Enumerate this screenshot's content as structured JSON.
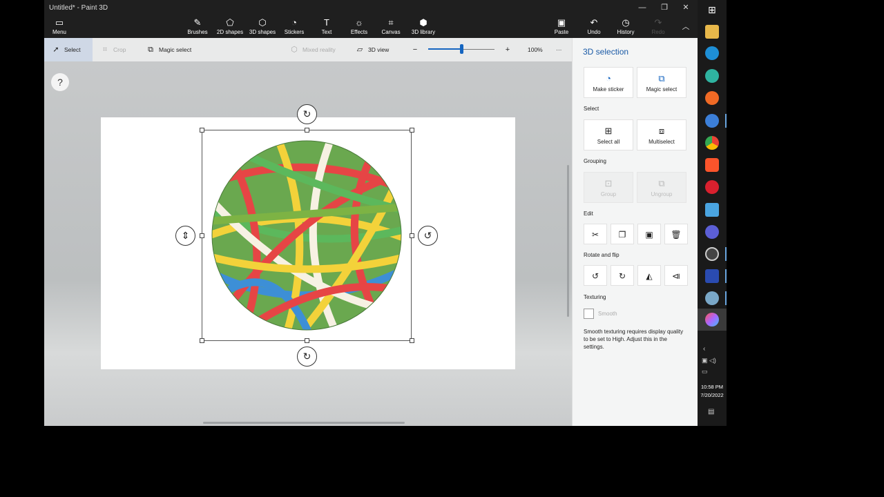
{
  "window": {
    "title": "Untitled* - Paint 3D"
  },
  "ribbon": {
    "menu": "Menu",
    "brushes": "Brushes",
    "shapes2d": "2D shapes",
    "shapes3d": "3D shapes",
    "stickers": "Stickers",
    "text": "Text",
    "effects": "Effects",
    "canvas": "Canvas",
    "library": "3D library",
    "paste": "Paste",
    "undo": "Undo",
    "history": "History",
    "redo": "Redo"
  },
  "toolbar": {
    "select": "Select",
    "crop": "Crop",
    "magic_select": "Magic select",
    "mixed_reality": "Mixed reality",
    "view3d": "3D view",
    "zoom_level": "100%",
    "zoom_fraction": 0.5,
    "more": "···"
  },
  "canvas": {
    "help": "?"
  },
  "panel": {
    "title": "3D selection",
    "make_sticker": "Make sticker",
    "magic_select": "Magic select",
    "select_section": "Select",
    "select_all": "Select all",
    "multiselect": "Multiselect",
    "grouping_section": "Grouping",
    "group": "Group",
    "ungroup": "Ungroup",
    "edit_section": "Edit",
    "rotate_section": "Rotate and flip",
    "texturing_section": "Texturing",
    "smooth": "Smooth",
    "texturing_note": "Smooth texturing requires display quality to be set to High. Adjust this in the settings."
  },
  "taskbar": {
    "time": "10:58 PM",
    "date": "7/20/2022"
  },
  "colors": {
    "accent": "#1565c0",
    "ribbon_bg": "#1f1f1f",
    "panel_title": "#1a5aa6"
  }
}
